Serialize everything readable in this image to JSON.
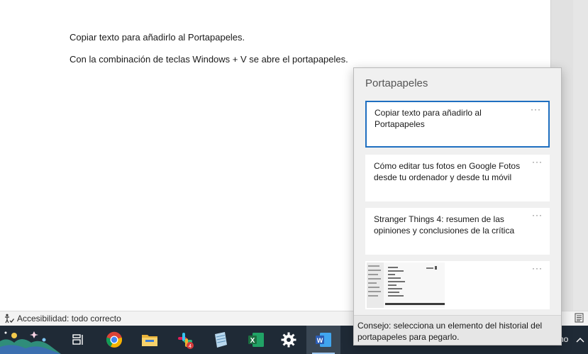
{
  "document": {
    "line_1": "Copiar texto para añadirlo al Portapapeles.",
    "line_2": "Con la combinación de teclas Windows + V se abre el portapapeles."
  },
  "status_bar": {
    "accessibility_label": "Accesibilidad: todo correcto",
    "accessibility_icon": "accessibility-person-icon",
    "layout_icon": "read-mode-icon"
  },
  "clipboard": {
    "title": "Portapapeles",
    "items": [
      {
        "text": "Copiar texto para añadirlo al Portapapeles",
        "more": "···",
        "selected": true
      },
      {
        "text": "Cómo editar tus fotos en Google Fotos desde tu ordenador y desde tu móvil",
        "more": "···"
      },
      {
        "text": "Stranger Things 4: resumen de las opiniones y conclusiones de la crítica",
        "more": "···"
      },
      {
        "type": "image",
        "more": "···"
      }
    ],
    "tip": "Consejo: selecciona un elemento del historial del portapapeles para pegarlo."
  },
  "taskbar": {
    "items": [
      {
        "icon": "weather-widget-icon"
      },
      {
        "icon": "task-view-icon"
      },
      {
        "icon": "chrome-icon"
      },
      {
        "icon": "file-explorer-icon"
      },
      {
        "icon": "slack-icon",
        "badge": "4"
      },
      {
        "icon": "notepad-icon"
      },
      {
        "icon": "excel-icon"
      },
      {
        "icon": "settings-gear-icon"
      },
      {
        "icon": "word-icon",
        "active": true
      }
    ],
    "tray_text": "ho"
  },
  "colors": {
    "accent_selected": "#1f6fc0",
    "taskbar_bg": "#1f2a36",
    "panel_bg": "#f0f0f0",
    "excel_green": "#1d6f42",
    "word_blue": "#2b5cb4"
  }
}
